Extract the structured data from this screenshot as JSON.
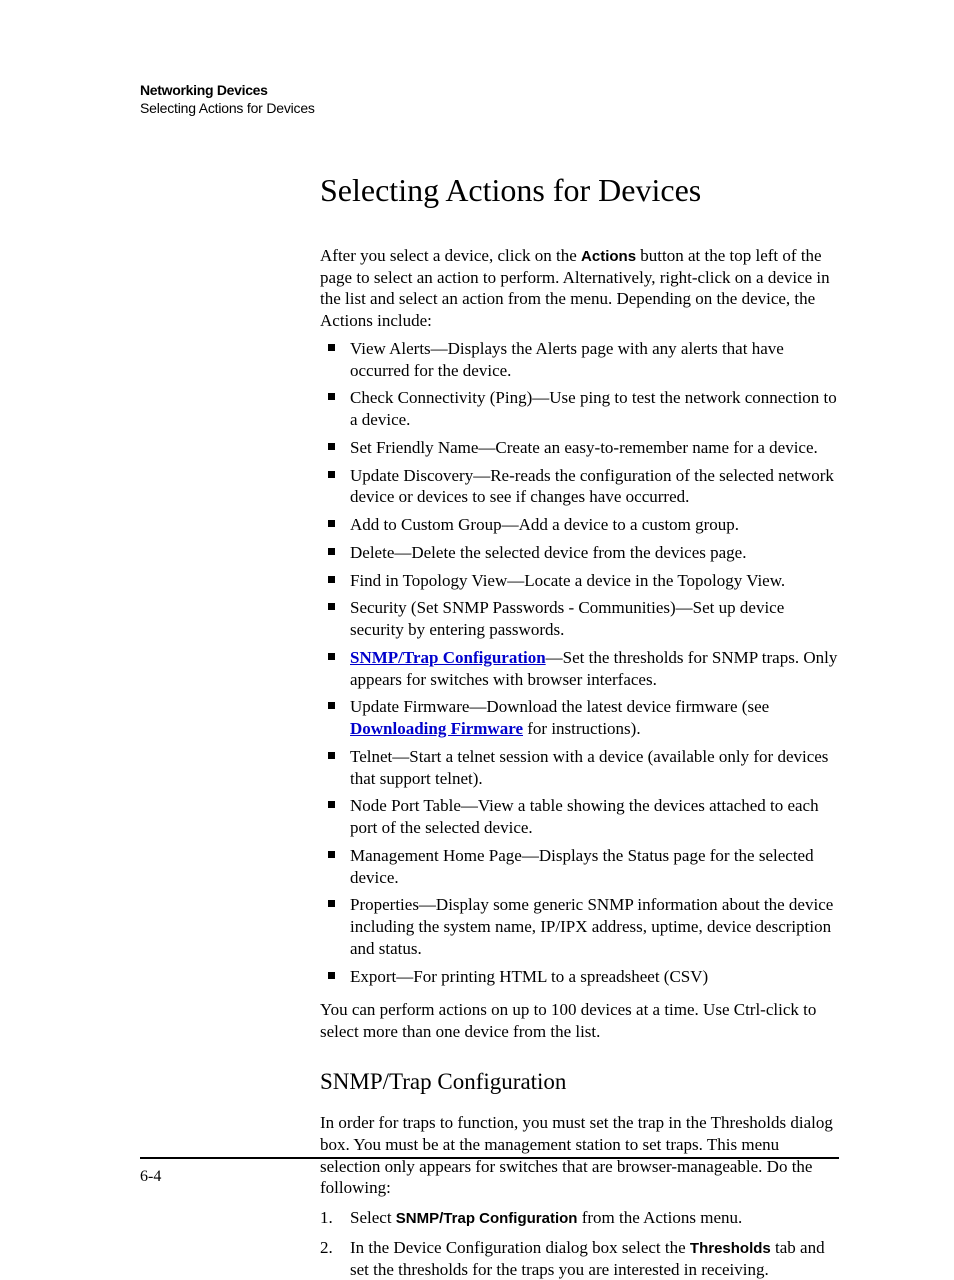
{
  "running_head": {
    "title": "Networking Devices",
    "subtitle": "Selecting Actions for Devices"
  },
  "h1": "Selecting Actions for Devices",
  "intro": {
    "pre": "After you select a device, click on the ",
    "bold": "Actions",
    "post": " button at the top left of the page to select an action to perform. Alternatively, right-click on a device in the list and select an action from the menu. Depending on the device, the Actions include:"
  },
  "bullets": {
    "b0": "View Alerts—Displays the Alerts page with any alerts that have occurred for the device.",
    "b1": "Check Connectivity (Ping)—Use ping to test the network connection to a device.",
    "b2": "Set Friendly Name—Create an easy-to-remember name for a device.",
    "b3": "Update Discovery—Re-reads the configuration of the selected network device or devices to see if changes have occurred.",
    "b4": "Add to Custom Group—Add a device to a custom group.",
    "b5": "Delete—Delete the selected device from the devices page.",
    "b6": "Find in Topology View—Locate a device in the Topology View.",
    "b7": "Security (Set SNMP Passwords - Communities)—Set up device security by entering passwords.",
    "b8_link": "SNMP/Trap Configuration",
    "b8_rest": "—Set the thresholds for SNMP traps. Only appears for switches with browser interfaces.",
    "b9_pre": "Update Firmware—Download the latest device firmware (see ",
    "b9_link": "Downloading Firmware",
    "b9_post": " for instructions).",
    "b10": "Telnet—Start a telnet session with a device (available only for devices that support telnet).",
    "b11": "Node Port Table—View a table showing the devices attached to each port of the selected device.",
    "b12": "Management Home Page—Displays the Status page for the selected device.",
    "b13": "Properties—Display some generic SNMP information about the device including the system name, IP/IPX address, uptime, device description and status.",
    "b14": "Export—For printing HTML to a spreadsheet (CSV)"
  },
  "after_list": "You can perform actions on up to 100 devices at a time. Use Ctrl-click to select more than one device from the list.",
  "h2": "SNMP/Trap Configuration",
  "snmp_intro": "In order for traps to function, you must set the trap in the Thresholds dialog box. You must be at the management station to set traps. This menu selection only appears for switches that are browser-manageable. Do the following:",
  "step1_pre": "Select ",
  "step1_bold": "SNMP/Trap Configuration",
  "step1_post": " from the Actions menu.",
  "step2_pre": "In the Device Configuration dialog box select the ",
  "step2_bold": "Thresholds",
  "step2_post": " tab and set the thresholds for the traps you are interested in receiving.",
  "page_number": "6-4"
}
